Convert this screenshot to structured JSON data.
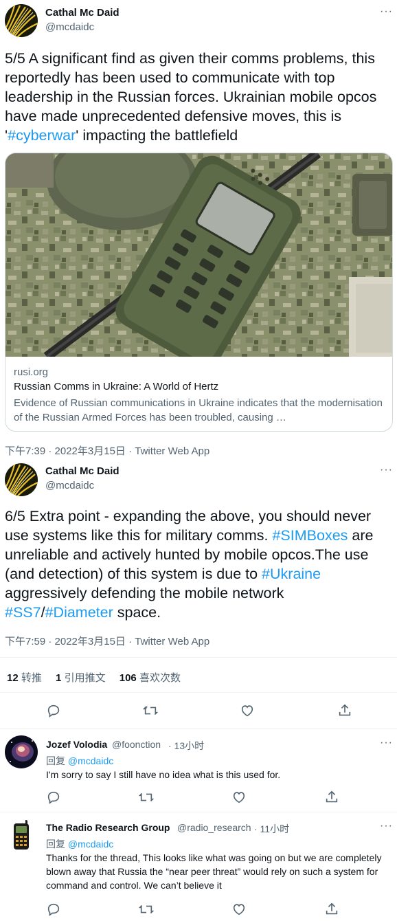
{
  "tweet1": {
    "author_name": "Cathal Mc Daid",
    "author_handle": "@mcdaidc",
    "text_before": "5/5 A significant find as given their comms problems, this reportedly has been used to communicate with top leadership in the Russian forces. Ukrainian mobile opcos have made unprecedented defensive moves, this is '",
    "hashtag": "#cyberwar",
    "text_after": "' impacting the battlefield",
    "card": {
      "domain": "rusi.org",
      "title": "Russian Comms in Ukraine: A World of Hertz",
      "description": "Evidence of Russian communications in Ukraine indicates that the modernisation of the Russian Armed Forces has been troubled, causing …"
    },
    "timestamp": "下午7:39 · 2022年3月15日 · Twitter Web App"
  },
  "tweet2": {
    "author_name": "Cathal Mc Daid",
    "author_handle": "@mcdaidc",
    "text_parts": [
      "6/5 Extra point - expanding the above, you should never use systems like this for military comms. ",
      "#SIMBoxes",
      " are unreliable and actively hunted by mobile opcos.The use (and detection) of this system is due to ",
      "#Ukraine",
      " aggressively defending the mobile network ",
      "#SS7",
      "/",
      "#Diameter",
      " space."
    ],
    "timestamp": "下午7:59 · 2022年3月15日 · Twitter Web App",
    "stats": {
      "retweets_count": "12",
      "retweets_label": "转推",
      "quotes_count": "1",
      "quotes_label": "引用推文",
      "likes_count": "106",
      "likes_label": "喜欢次数"
    }
  },
  "replies": [
    {
      "name": "Jozef Volodia",
      "handle": "@foonction",
      "time": "· 13小时",
      "reply_prefix": "回复",
      "reply_to": "@mcdaidc",
      "text": "I'm sorry to say I still have no idea what is this used for."
    },
    {
      "name": "The Radio Research Group",
      "handle": "@radio_research",
      "time": "· 11小时",
      "reply_prefix": "回复",
      "reply_to": "@mcdaidc",
      "text": "Thanks for the thread, This looks like what was going on but we are completely blown away that Russia the “near peer threat” would rely on such a system for command and control. We can’t believe it"
    }
  ],
  "icons": {
    "more": "more-icon",
    "reply": "reply-icon",
    "retweet": "retweet-icon",
    "like": "like-icon",
    "share": "share-icon"
  },
  "colors": {
    "link": "#1d9bf0",
    "secondary_text": "#536471",
    "primary_text": "#0f1419"
  }
}
